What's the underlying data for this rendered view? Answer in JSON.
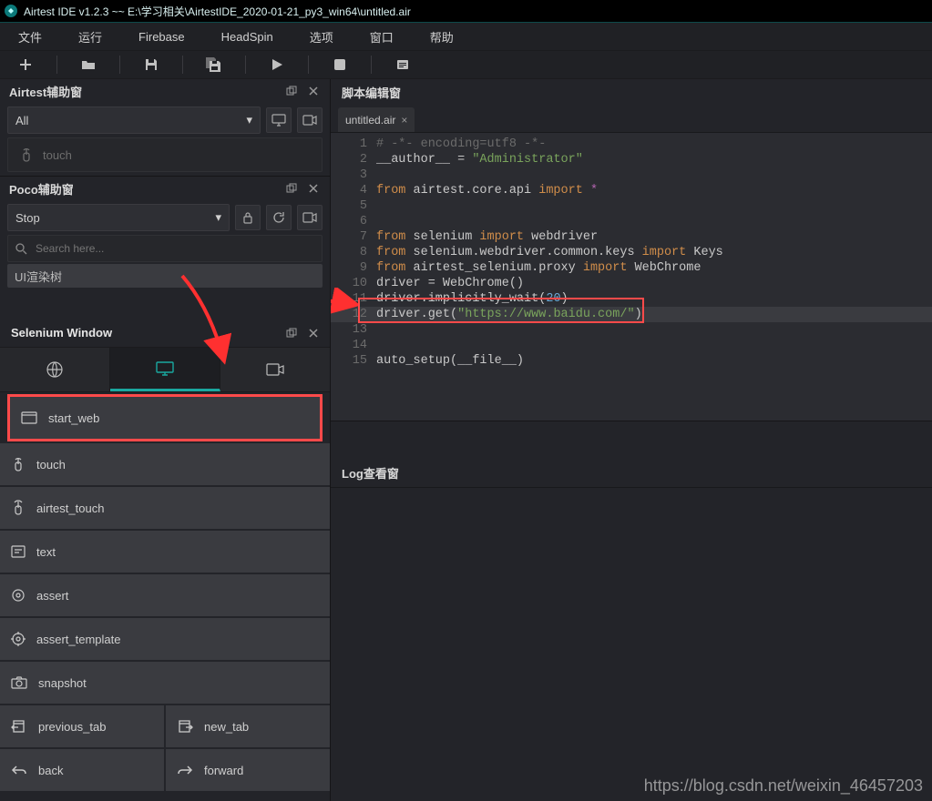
{
  "title_bar": "Airtest IDE v1.2.3 ~~ E:\\学习相关\\AirtestIDE_2020-01-21_py3_win64\\untitled.air",
  "menu": {
    "file": "文件",
    "run": "运行",
    "firebase": "Firebase",
    "headspin": "HeadSpin",
    "options": "选项",
    "window": "窗口",
    "help": "帮助"
  },
  "panels": {
    "airtest_assist": "Airtest辅助窗",
    "poco_assist": "Poco辅助窗",
    "selenium_window": "Selenium Window",
    "editor": "脚本编辑窗",
    "log": "Log查看窗"
  },
  "airtest": {
    "filter": "All",
    "touch": "touch"
  },
  "poco": {
    "mode": "Stop",
    "search": "Search here...",
    "ui_root": "UI渲染树"
  },
  "selenium": {
    "cmds": {
      "start_web": "start_web",
      "touch": "touch",
      "airtest_touch": "airtest_touch",
      "text": "text",
      "assert": "assert",
      "assert_template": "assert_template",
      "snapshot": "snapshot",
      "previous_tab": "previous_tab",
      "new_tab": "new_tab",
      "back": "back",
      "forward": "forward"
    }
  },
  "editor_tab": "untitled.air",
  "code": {
    "l1_a": "# -*- encoding=utf8 -*-",
    "l2_a": "__author__ = ",
    "l2_b": "\"Administrator\"",
    "l4_a": "from",
    "l4_b": " airtest.core.api ",
    "l4_c": "import",
    "l4_d": " *",
    "l7_a": "from",
    "l7_b": " selenium ",
    "l7_c": "import",
    "l7_d": " webdriver",
    "l8_a": "from",
    "l8_b": " selenium.webdriver.common.keys ",
    "l8_c": "import",
    "l8_d": " Keys",
    "l9_a": "from",
    "l9_b": " airtest_selenium.proxy ",
    "l9_c": "import",
    "l9_d": " WebChrome",
    "l10": "driver = WebChrome()",
    "l11_a": "driver.implicitly_wait(",
    "l11_b": "20",
    "l11_c": ")",
    "l12_a": "driver.get(",
    "l12_b": "\"https://www.baidu.com/\"",
    "l12_c": ")",
    "l15": "auto_setup(__file__)"
  },
  "line_numbers": [
    "1",
    "2",
    "3",
    "4",
    "5",
    "6",
    "7",
    "8",
    "9",
    "10",
    "11",
    "12",
    "13",
    "14",
    "15"
  ],
  "watermark": "https://blog.csdn.net/weixin_46457203"
}
